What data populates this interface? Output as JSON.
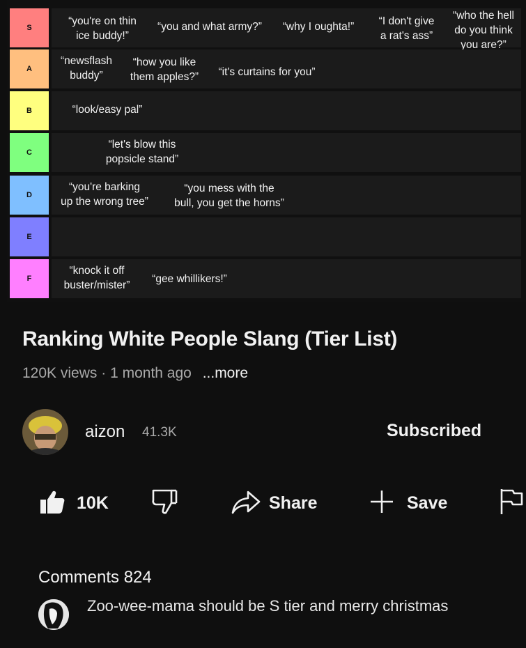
{
  "tierlist": {
    "tiers": [
      {
        "label": "S",
        "color": "#ff7f7f",
        "items": [
          "“you're on thin\nice buddy!”",
          "“you and what army?”",
          "“why I oughta!”",
          "“I don't give\na rat's ass”",
          "“who the hell\ndo you think\nyou are?”"
        ]
      },
      {
        "label": "A",
        "color": "#ffbf7f",
        "items": [
          "“newsflash\nbuddy”",
          "“how you like\nthem apples?”",
          "“it's curtains for you”"
        ]
      },
      {
        "label": "B",
        "color": "#ffff7f",
        "items": [
          "“look/easy pal”"
        ]
      },
      {
        "label": "C",
        "color": "#7fff7f",
        "items": [
          "“let's blow this\npopsicle stand”"
        ]
      },
      {
        "label": "D",
        "color": "#7fbfff",
        "items": [
          "“you're barking\nup the wrong tree”",
          "“you mess with the\nbull, you get the horns”"
        ]
      },
      {
        "label": "E",
        "color": "#7f7fff",
        "items": []
      },
      {
        "label": "F",
        "color": "#ff7fff",
        "items": [
          "“knock it off\nbuster/mister”",
          "“gee whillikers!”"
        ]
      }
    ]
  },
  "video": {
    "title": "Ranking White People Slang (Tier List)",
    "views": "120K views",
    "separator": "·",
    "age": "1 month ago",
    "more": "...more"
  },
  "channel": {
    "name": "aizon",
    "subscribers": "41.3K",
    "subscribe_state": "Subscribed"
  },
  "actions": {
    "like_count": "10K",
    "share_label": "Share",
    "save_label": "Save",
    "icons": [
      "thumbs-up-icon",
      "thumbs-down-icon",
      "share-icon",
      "plus-icon",
      "flag-icon"
    ]
  },
  "comments": {
    "header": "Comments 824",
    "top_comment": "Zoo-wee-mama should be S tier and merry christmas"
  }
}
